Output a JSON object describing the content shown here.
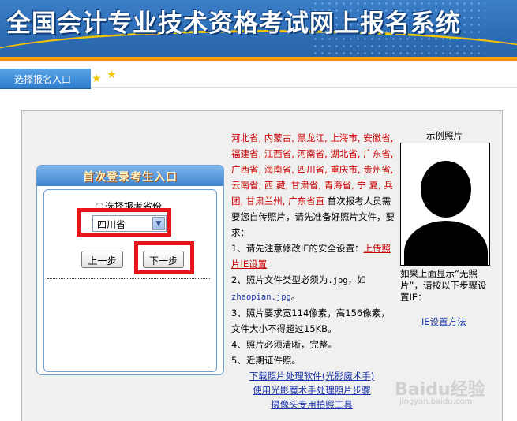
{
  "header": {
    "title": "全国会计专业技术资格考试网上报名系统"
  },
  "nav": {
    "tab_label": "选择报名入口"
  },
  "login": {
    "title": "首次登录考生入口",
    "radio_label": "选择报考省份",
    "province_selected": "四川省",
    "prev_label": "上一步",
    "next_label": "下一步"
  },
  "info": {
    "provinces": "河北省, 内蒙古, 黑龙江, 上海市, 安徽省, 福建省, 江西省, 河南省, 湖北省, 广东省, 广西省, 海南省, 四川省, 重庆市, 贵州省, 云南省, 西 藏, 甘肃省, 青海省, 宁 夏, 兵 团, 甘肃兰州, 广东省直",
    "intro": " 首次报考人员需要您自传照片，请先准备好照片文件，要求：",
    "req1_prefix": "1、请先注意修改IE的安全设置：",
    "req1_link": "上传照片IE设置",
    "req2_prefix": "2、照片文件类型必须为",
    "req2_ext": ".jpg",
    "req2_mid": "，如",
    "req2_example": "zhaopian.jpg",
    "req2_end": "。",
    "req3": "3、照片要求宽114像素，高156像素，文件大小不得超过15KB。",
    "req4": "4、照片必须清晰，完整。",
    "req5": "5、近期证件照。"
  },
  "sample": {
    "title": "示例照片",
    "note": "如果上面显示“无照片”，请按以下步骤设置IE：",
    "ie_link": "IE设置方法"
  },
  "bottom_links": [
    "下载照片处理软件(光影魔术手)",
    "使用光影魔术手处理照片步骤",
    "摄像头专用拍照工具"
  ],
  "watermark": {
    "text": "Baidu经验",
    "sub": "jingyan.baidu.com"
  }
}
